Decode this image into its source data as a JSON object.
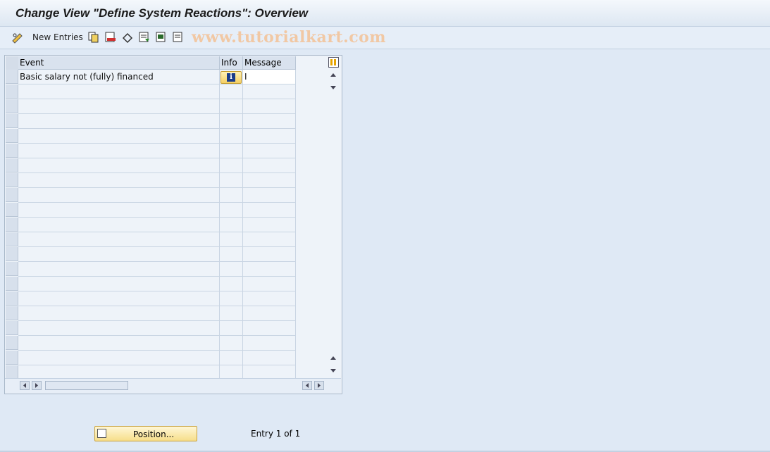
{
  "window": {
    "title": "Change View \"Define System Reactions\": Overview"
  },
  "toolbar": {
    "new_entries_label": "New Entries",
    "icons": [
      "glasses-edit-icon",
      "copy-icon",
      "delete-icon",
      "undo-icon",
      "select-all-icon",
      "select-block-icon",
      "deselect-all-icon"
    ]
  },
  "watermark": "www.tutorialkart.com",
  "table": {
    "columns": [
      "Event",
      "Info",
      "Message"
    ],
    "rows": [
      {
        "event": "Basic salary not (fully) financed",
        "message": "I"
      }
    ],
    "empty_rows": 20
  },
  "footer": {
    "position_label": "Position...",
    "entry_count": "Entry 1 of 1"
  },
  "colors": {
    "background": "#dfe9f5",
    "button_yellow": "#f6de8a",
    "info_icon": "#1a3c8a"
  }
}
